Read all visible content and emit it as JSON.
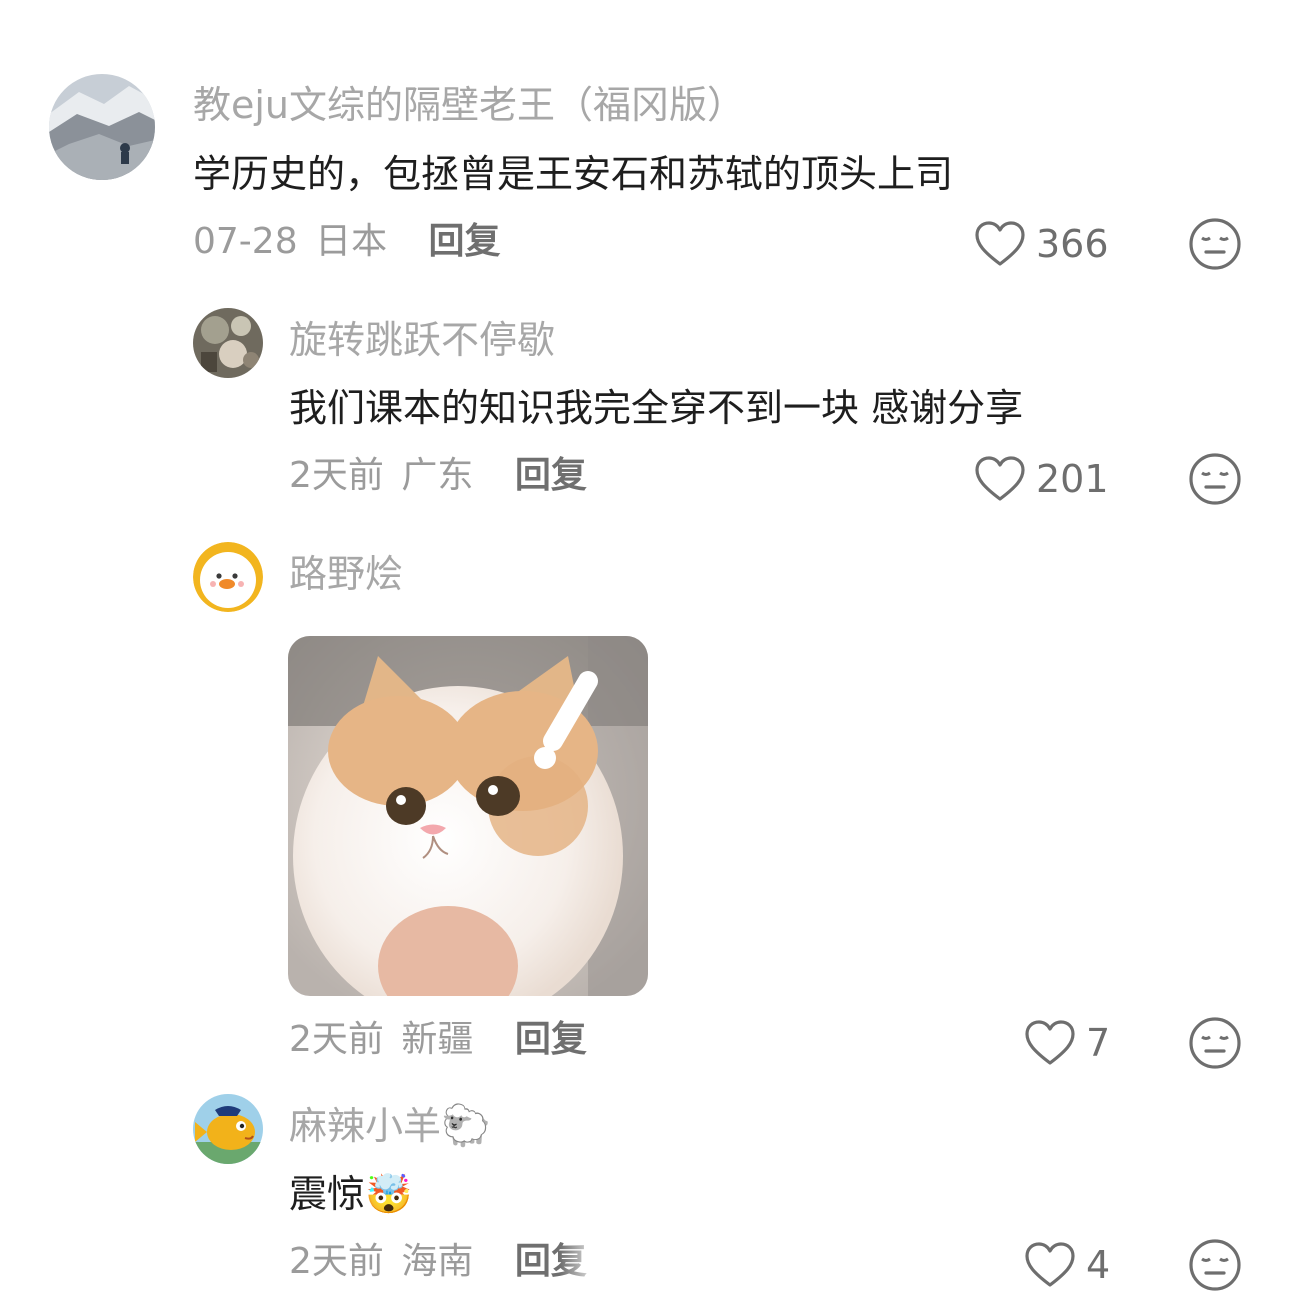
{
  "comments": [
    {
      "username": "教eju文综的隔壁老王（福冈版）",
      "text": "学历史的，包拯曾是王安石和苏轼的顶头上司",
      "date": "07-28",
      "location": "日本",
      "reply_label": "回复",
      "likes": "366"
    },
    {
      "username": "旋转跳跃不停歇",
      "text": "我们课本的知识我完全穿不到一块 感谢分享",
      "date": "2天前",
      "location": "广东",
      "reply_label": "回复",
      "likes": "201"
    },
    {
      "username": "路野烩",
      "text": "",
      "date": "2天前",
      "location": "新疆",
      "reply_label": "回复",
      "likes": "7"
    },
    {
      "username": "麻辣小羊",
      "username_emoji": "🐑",
      "text": "震惊",
      "text_emoji": "🤯",
      "date": "2天前",
      "location": "海南",
      "reply_label": "回复",
      "likes": "4"
    }
  ],
  "icons": {
    "like": "heart-outline-icon",
    "dislike": "neutral-face-icon"
  },
  "colors": {
    "username": "#a7a7a7",
    "text": "#1e1e1e",
    "meta": "#9b9b9b",
    "reply": "#6f6f6f",
    "icon": "#6e6e6e"
  }
}
